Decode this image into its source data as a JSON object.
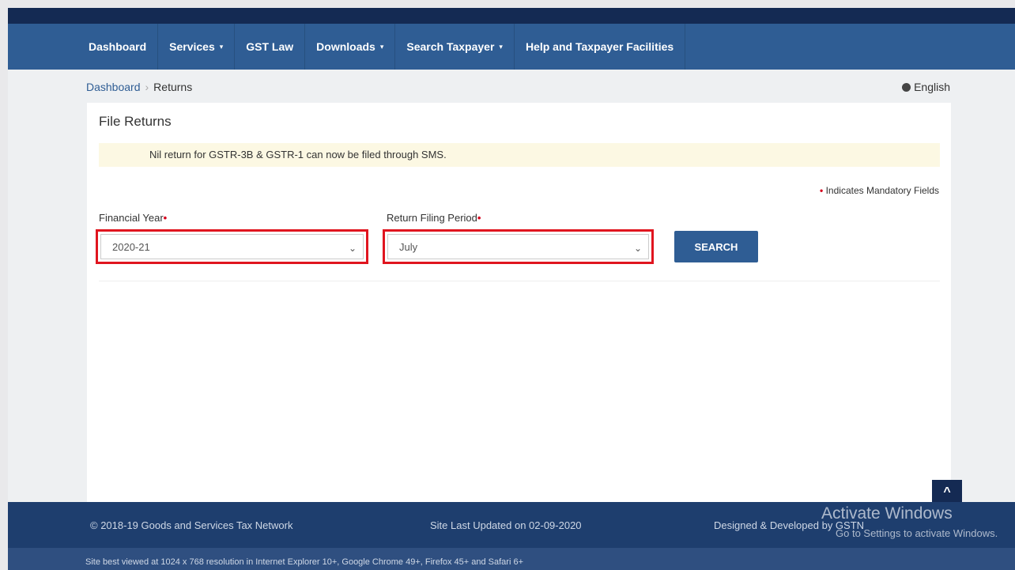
{
  "nav": {
    "items": [
      {
        "label": "Dashboard",
        "has_caret": false
      },
      {
        "label": "Services",
        "has_caret": true
      },
      {
        "label": "GST Law",
        "has_caret": false
      },
      {
        "label": "Downloads",
        "has_caret": true
      },
      {
        "label": "Search Taxpayer",
        "has_caret": true
      },
      {
        "label": "Help and Taxpayer Facilities",
        "has_caret": false
      }
    ],
    "caret": "▾"
  },
  "breadcrumb": {
    "root": "Dashboard",
    "separator": "›",
    "current": "Returns"
  },
  "language": "English",
  "panel": {
    "title": "File Returns",
    "alert": "Nil return for GSTR-3B & GSTR-1 can now be filed through SMS.",
    "mandatory_mark": "•",
    "mandatory_text": "Indicates Mandatory Fields"
  },
  "form": {
    "financial_year_label": "Financial Year",
    "financial_year_value": "2020-21",
    "return_period_label": "Return Filing Period",
    "return_period_value": "July",
    "required_mark": "•",
    "dropdown_glyph": "⌄",
    "search_label": "SEARCH"
  },
  "scroll_top_glyph": "^",
  "footer": {
    "copyright": "© 2018-19 Goods and Services Tax Network",
    "updated": "Site Last Updated on 02-09-2020",
    "designed": "Designed & Developed by GSTN",
    "compat_note": "Site best viewed at 1024 x 768 resolution in Internet Explorer 10+, Google Chrome 49+, Firefox 45+ and Safari 6+"
  },
  "watermark": {
    "title": "Activate Windows",
    "subtitle": "Go to Settings to activate Windows."
  },
  "colors": {
    "nav_bg": "#2f5d94",
    "top_band": "#142a53",
    "alert_bg": "#fcf8e3",
    "highlight_border": "#e0151f",
    "required": "#d6001c",
    "button_bg": "#2f5d94",
    "footer_bg": "#1e3e6e"
  }
}
